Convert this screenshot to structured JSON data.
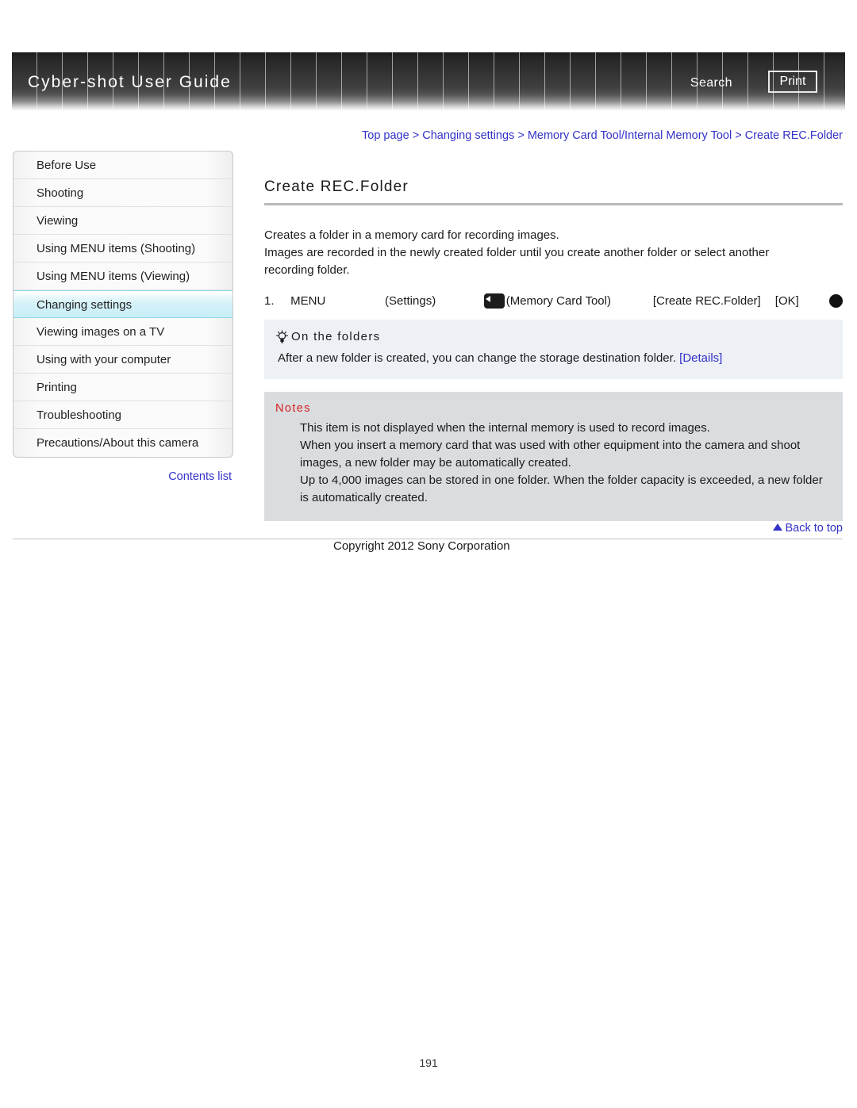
{
  "header": {
    "title": "Cyber-shot User Guide",
    "search_label": "Search",
    "print_label": "Print"
  },
  "breadcrumb": {
    "items": [
      "Top page",
      "Changing settings",
      "Memory Card Tool/Internal Memory Tool",
      "Create REC.Folder"
    ],
    "separator": " > "
  },
  "sidebar": {
    "items": [
      {
        "label": "Before Use",
        "active": false
      },
      {
        "label": "Shooting",
        "active": false
      },
      {
        "label": "Viewing",
        "active": false
      },
      {
        "label": "Using MENU items (Shooting)",
        "active": false
      },
      {
        "label": "Using MENU items (Viewing)",
        "active": false
      },
      {
        "label": "Changing settings",
        "active": true
      },
      {
        "label": "Viewing images on a TV",
        "active": false
      },
      {
        "label": "Using with your computer",
        "active": false
      },
      {
        "label": "Printing",
        "active": false
      },
      {
        "label": "Troubleshooting",
        "active": false
      },
      {
        "label": "Precautions/About this camera",
        "active": false
      }
    ],
    "contents_list_label": "Contents list"
  },
  "main": {
    "title": "Create REC.Folder",
    "intro_line_1": "Creates a folder in a memory card for recording images.",
    "intro_line_2": "Images are recorded in the newly created folder until you create another folder or select another",
    "intro_line_3": "recording folder.",
    "step": {
      "number": "1.",
      "menu": "MENU",
      "settings": "(Settings)",
      "memory_card_tool": "(Memory Card Tool)",
      "create_rec_folder": "[Create REC.Folder]",
      "ok": "[OK]"
    },
    "tip": {
      "heading": "On the folders",
      "text": "After a new folder is created, you can change the storage destination folder. ",
      "link_label": "[Details]"
    },
    "notes": {
      "heading": "Notes",
      "items": [
        "This item is not displayed when the internal memory is used to record images.",
        "When you insert a memory card that was used with other equipment into the camera and shoot images, a new folder may be automatically created.",
        "Up to 4,000 images can be stored in one folder. When the folder capacity is exceeded, a new folder is automatically created."
      ]
    }
  },
  "footer": {
    "back_to_top_label": "Back to top",
    "copyright": "Copyright 2012 Sony Corporation",
    "page_number": "191"
  },
  "colors": {
    "link": "#3232c8",
    "notes_heading": "#d42020",
    "active_sidebar": "#c8eef7"
  }
}
